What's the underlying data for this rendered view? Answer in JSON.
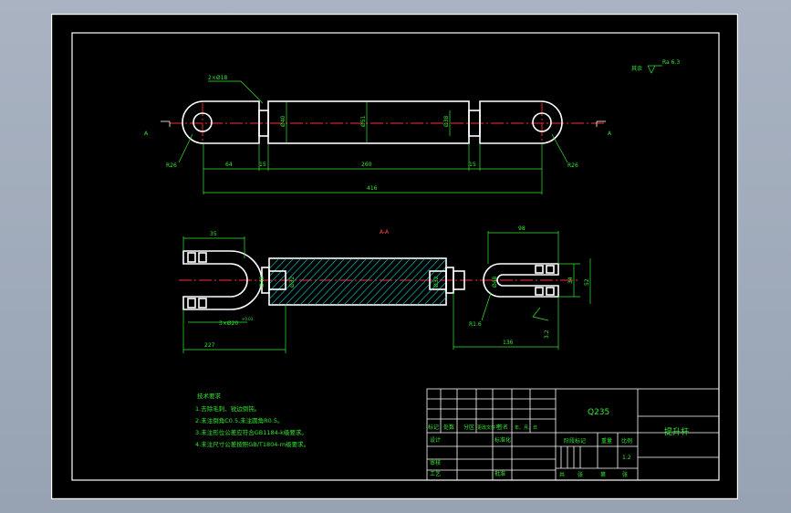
{
  "colors": {
    "background": "#000000",
    "outline": "#ffffff",
    "dimension": "#33e833",
    "centerline": "#ff2b2b",
    "hatch": "#00d6d6",
    "window": "#a9b3c2"
  },
  "top_view": {
    "section_marker": "A",
    "hole_label": "2×Ø18",
    "radius_left": "R26",
    "radius_right": "R26",
    "dims": [
      "64",
      "15",
      "260",
      "15",
      "416"
    ],
    "diameters": [
      "Ø40",
      "Ø51",
      "Ø38"
    ]
  },
  "section_view": {
    "title": "A-A",
    "dims": [
      "35",
      "98",
      "227",
      "136",
      "34",
      "52"
    ],
    "diameters": [
      "Ø48",
      "Ø32",
      "Ø32",
      "Ø48"
    ],
    "hole_label": "3×Ø20",
    "hole_tol": "+0.03",
    "radius": "R1.6",
    "roughness_side": "3.2"
  },
  "roughness_global": {
    "label": "其余",
    "value": "Ra 6.3"
  },
  "notes": {
    "title": "技术要求",
    "items": [
      "1.去除毛刺、锐边倒钝。",
      "2.未注倒角C0.5,未注圆角R0.5。",
      "3.未注形位公差应符合GB1184-k级要求。",
      "4.未注尺寸公差按照GB/T1804-m级要求。"
    ]
  },
  "title_block": {
    "material": "Q235",
    "part_name": "提升杆",
    "row_labels": [
      "标记",
      "处数",
      "分区",
      "更改文件号",
      "签名",
      "年、月、日"
    ],
    "designer": "设计",
    "standardize": "标准化",
    "stage_mark": "阶段标记",
    "weight": "重量",
    "scale_label": "比例",
    "scale": "1:2",
    "review": "审核",
    "process": "工艺",
    "approve": "批准",
    "sheet_total": "共",
    "sheet_num": "张",
    "sheet_of": "第",
    "sheet_unit": "张"
  }
}
